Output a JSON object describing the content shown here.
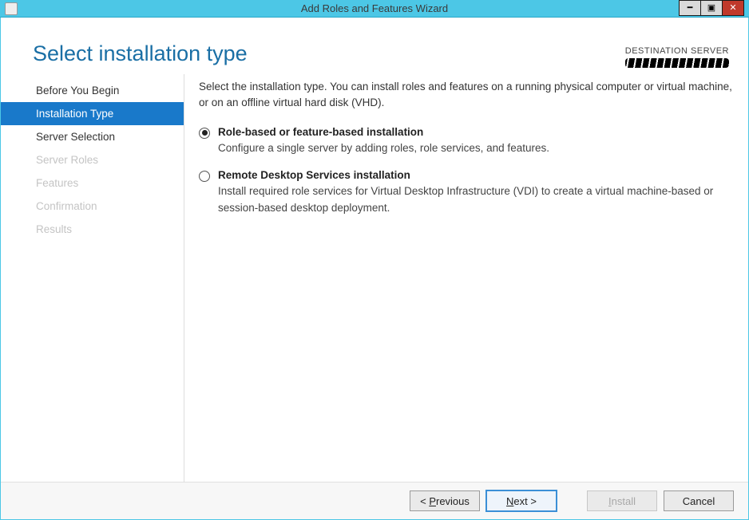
{
  "window": {
    "title": "Add Roles and Features Wizard"
  },
  "header": {
    "title": "Select installation type",
    "destination_label": "DESTINATION SERVER"
  },
  "sidebar": {
    "items": [
      {
        "label": "Before You Begin",
        "state": "enabled"
      },
      {
        "label": "Installation Type",
        "state": "selected"
      },
      {
        "label": "Server Selection",
        "state": "enabled"
      },
      {
        "label": "Server Roles",
        "state": "disabled"
      },
      {
        "label": "Features",
        "state": "disabled"
      },
      {
        "label": "Confirmation",
        "state": "disabled"
      },
      {
        "label": "Results",
        "state": "disabled"
      }
    ]
  },
  "content": {
    "intro": "Select the installation type. You can install roles and features on a running physical computer or virtual machine, or on an offline virtual hard disk (VHD).",
    "options": [
      {
        "title": "Role-based or feature-based installation",
        "desc": "Configure a single server by adding roles, role services, and features.",
        "selected": true
      },
      {
        "title": "Remote Desktop Services installation",
        "desc": "Install required role services for Virtual Desktop Infrastructure (VDI) to create a virtual machine-based or session-based desktop deployment.",
        "selected": false
      }
    ]
  },
  "footer": {
    "previous": "< Previous",
    "next": "Next >",
    "install": "Install",
    "cancel": "Cancel"
  }
}
